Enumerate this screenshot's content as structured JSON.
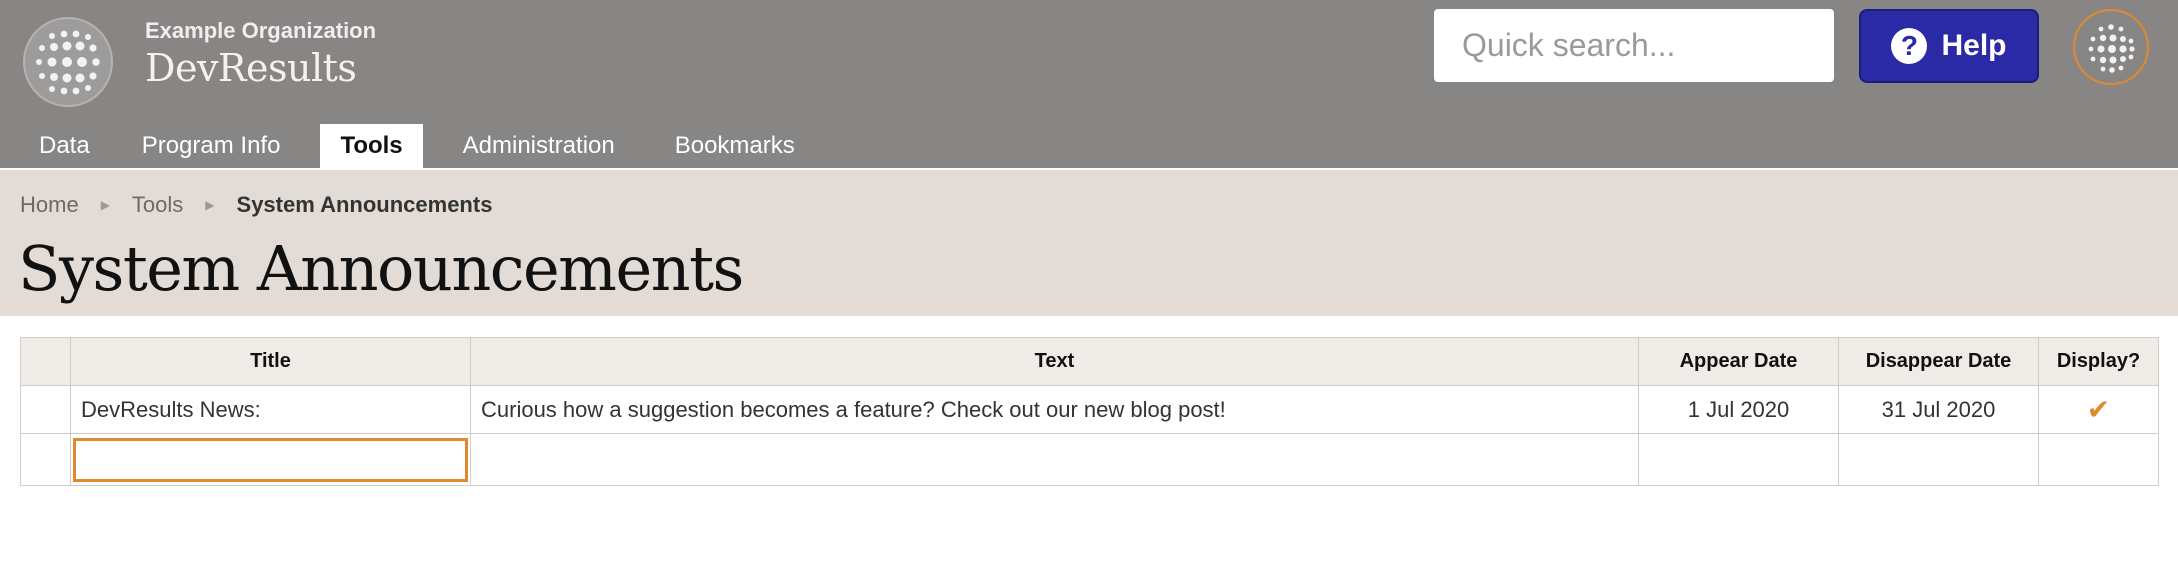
{
  "header": {
    "org_name": "Example Organization",
    "app_name": "DevResults",
    "search_placeholder": "Quick search...",
    "help_label": "Help"
  },
  "nav": {
    "items": [
      {
        "label": "Data"
      },
      {
        "label": "Program Info"
      },
      {
        "label": "Tools",
        "active": true
      },
      {
        "label": "Administration"
      },
      {
        "label": "Bookmarks"
      }
    ]
  },
  "breadcrumb": {
    "home": "Home",
    "tools": "Tools",
    "current": "System Announcements"
  },
  "page": {
    "title": "System Announcements"
  },
  "table": {
    "columns": [
      "Title",
      "Text",
      "Appear Date",
      "Disappear Date",
      "Display?"
    ],
    "rows": [
      {
        "title": "DevResults News:",
        "text": "Curious how a suggestion becomes a feature? Check out our new blog post!",
        "appear": "1 Jul 2020",
        "disappear": "31 Jul 2020",
        "display": true
      }
    ],
    "new_row_title_value": ""
  },
  "colors": {
    "header_bg": "#888685",
    "help_bg": "#2a2aa6",
    "accent_orange": "#e08a2e",
    "crumb_band": "#e3dcd6"
  },
  "icons": {
    "search": "search-icon",
    "help": "help-icon",
    "check": "check-icon",
    "logo": "globe-logo-icon"
  }
}
